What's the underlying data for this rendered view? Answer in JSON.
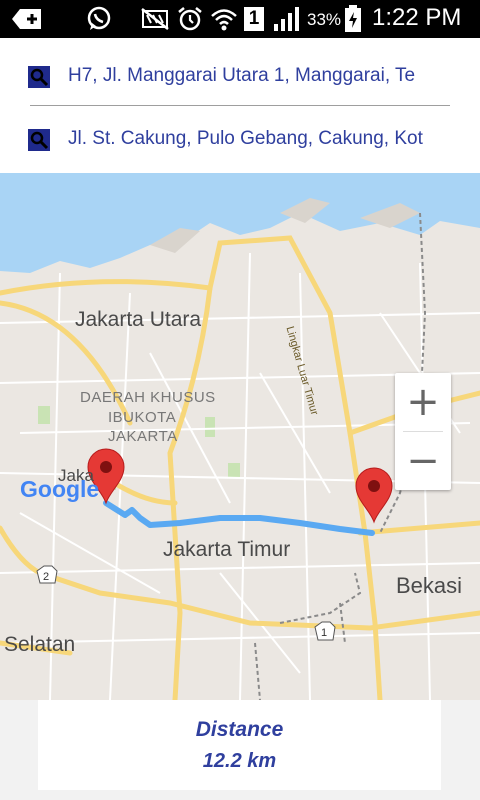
{
  "status_bar": {
    "battery": "33%",
    "time": "1:22 PM",
    "sim": "1"
  },
  "search": {
    "origin": "H7, Jl. Manggarai Utara 1, Manggarai, Te",
    "destination": "Jl. St. Cakung, Pulo Gebang, Cakung, Kot"
  },
  "map": {
    "labels": {
      "jakarta_utara": "Jakarta Utara",
      "dki_line1": "DAERAH KHUSUS",
      "dki_line2": "IBUKOTA",
      "dki_line3": "JAKARTA",
      "jaka": "Jaka",
      "jakarta_timur": "Jakarta Timur",
      "bekasi": "Bekasi",
      "selatan": "Selatan",
      "lingkar": "Lingkar Luar Timur",
      "route_2": "2",
      "route_1": "1",
      "google": "Google"
    },
    "zoom_in": "+",
    "zoom_out": "−",
    "colors": {
      "water": "#a9d4f5",
      "land": "#ebe7e2",
      "highway": "#f7d77a",
      "route": "#5aa9f2",
      "marker": "#e53935"
    }
  },
  "distance": {
    "title": "Distance",
    "value": "12.2 km"
  }
}
